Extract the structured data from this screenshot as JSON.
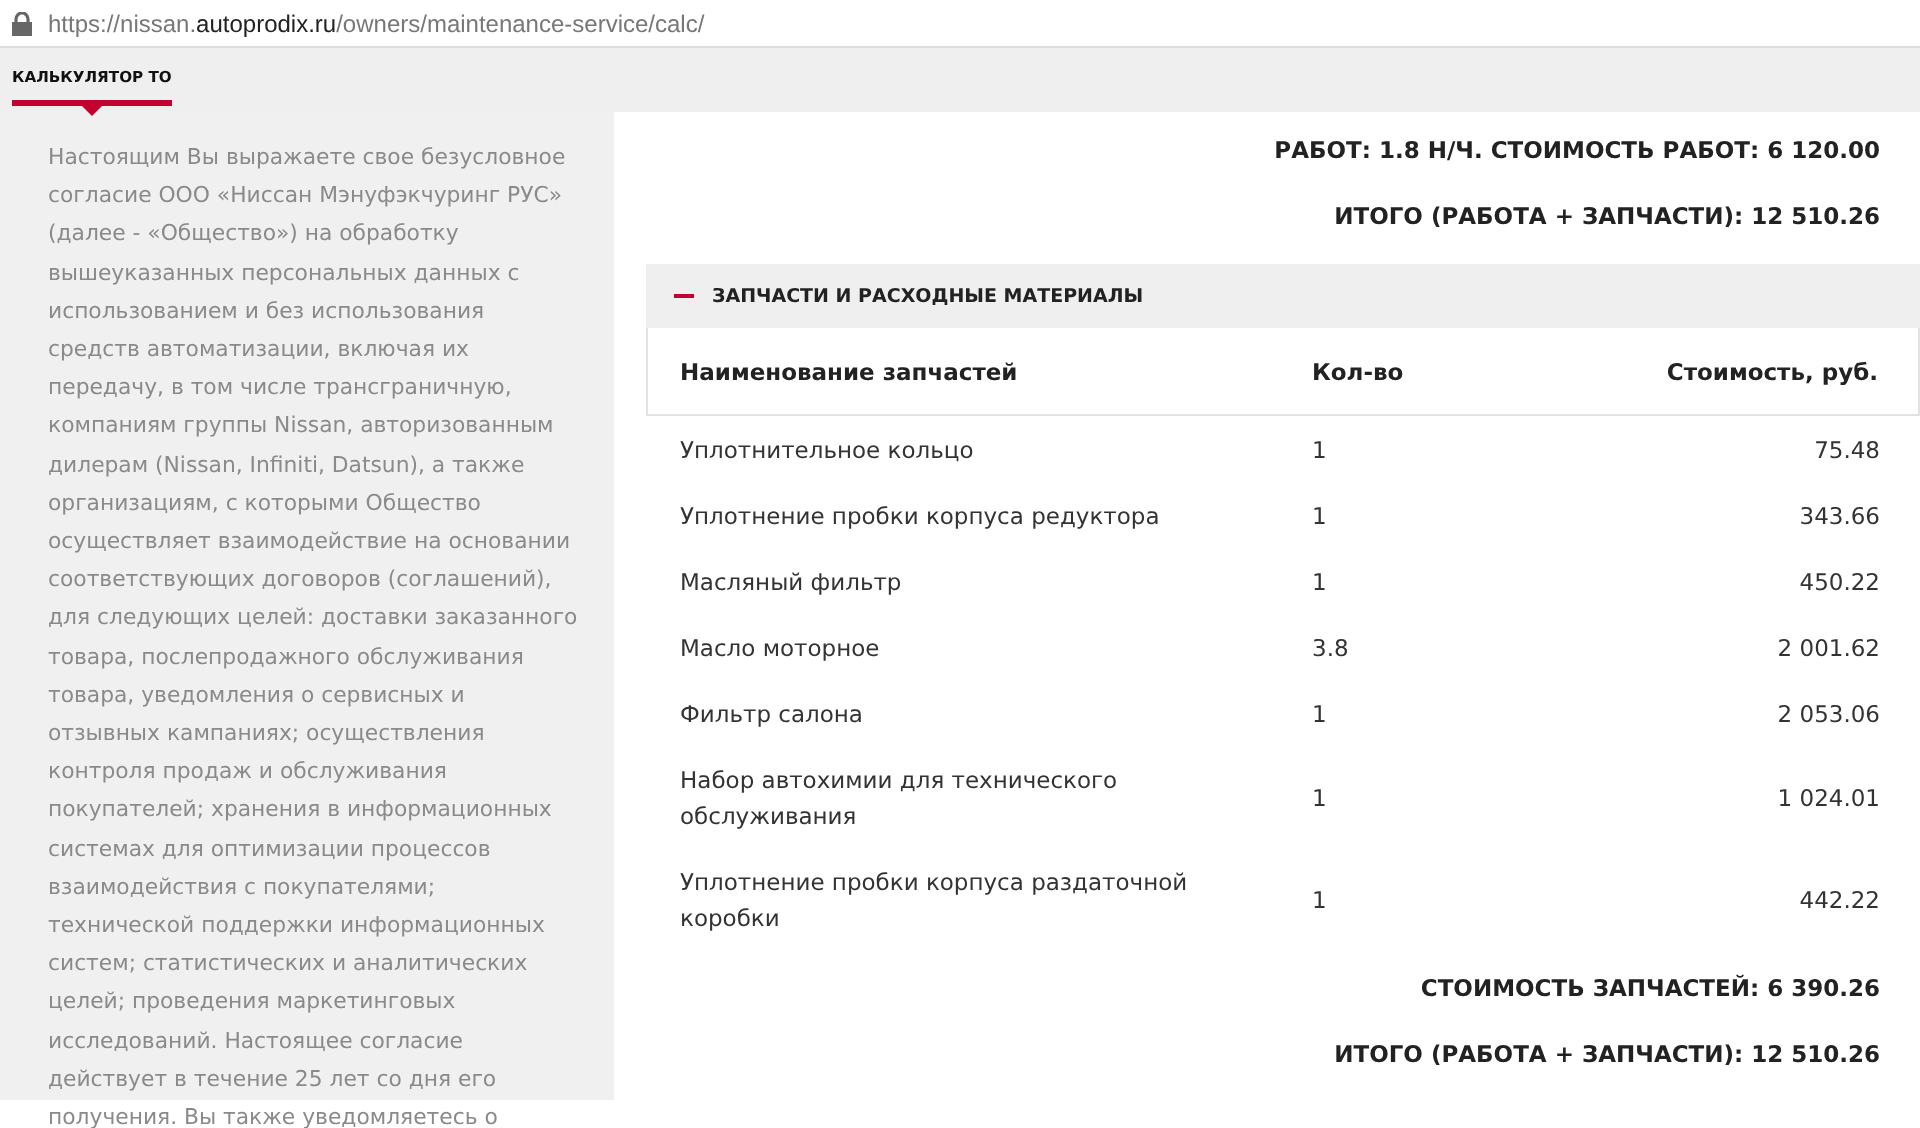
{
  "address_bar": {
    "url_prefix": "https://nissan.",
    "url_domain": "autoprodix.ru",
    "url_path": "/owners/maintenance-service/calc/"
  },
  "tabs": [
    {
      "label": "КАЛЬКУЛЯТОР ТО",
      "selected": true
    }
  ],
  "consent_text": "Настоящим Вы выражаете свое безусловное согласие ООО «Ниссан Мэнуфэкчуринг РУС» (далее - «Общество») на обработку вышеуказанных персональных данных с использованием и без использования средств автоматизации, включая их передачу, в том числе трансграничную, компаниям группы Nissan, авторизованным дилерам (Nissan, Infiniti, Datsun), а также организациям, с которыми Общество осуществляет взаимодействие на основании соответствующих договоров (соглашений), для следующих целей: доставки заказанного товара, послепродажного обслуживания товара, уведомления о сервисных и отзывных кампаниях; осуществления контроля продаж и обслуживания покупателей; хранения в информационных системах для оптимизации процессов взаимодействия с покупателями; технической поддержки информационных систем; статистических и аналитических целей; проведения маркетинговых исследований. Настоящее согласие действует в течение 25 лет со дня его получения. Вы также уведомляетесь о",
  "summary_top": [
    "РАБОТ: 1.8 Н/Ч. СТОИМОСТЬ РАБОТ: 6 120.00",
    "ИТОГО (РАБОТА + ЗАПЧАСТИ): 12 510.26"
  ],
  "parts_section": {
    "title": "ЗАПЧАСТИ И РАСХОДНЫЕ МАТЕРИАЛЫ",
    "expanded": true,
    "columns": [
      "Наименование запчастей",
      "Кол-во",
      "Стоимость, руб."
    ],
    "rows": [
      {
        "name": "Уплотнительное кольцо",
        "qty": "1",
        "cost": "75.48"
      },
      {
        "name": "Уплотнение пробки корпуса редуктора",
        "qty": "1",
        "cost": "343.66"
      },
      {
        "name": "Масляный фильтр",
        "qty": "1",
        "cost": "450.22"
      },
      {
        "name": "Масло моторное",
        "qty": "3.8",
        "cost": "2 001.62"
      },
      {
        "name": "Фильтр салона",
        "qty": "1",
        "cost": "2 053.06"
      },
      {
        "name": "Набор автохимии для технического обслуживания",
        "qty": "1",
        "cost": "1 024.01"
      },
      {
        "name": "Уплотнение пробки корпуса раздаточной коробки",
        "qty": "1",
        "cost": "442.22"
      }
    ]
  },
  "summary_bottom": [
    "СТОИМОСТЬ ЗАПЧАСТЕЙ: 6 390.26",
    "ИТОГО (РАБОТА + ЗАПЧАСТИ): 12 510.26"
  ]
}
